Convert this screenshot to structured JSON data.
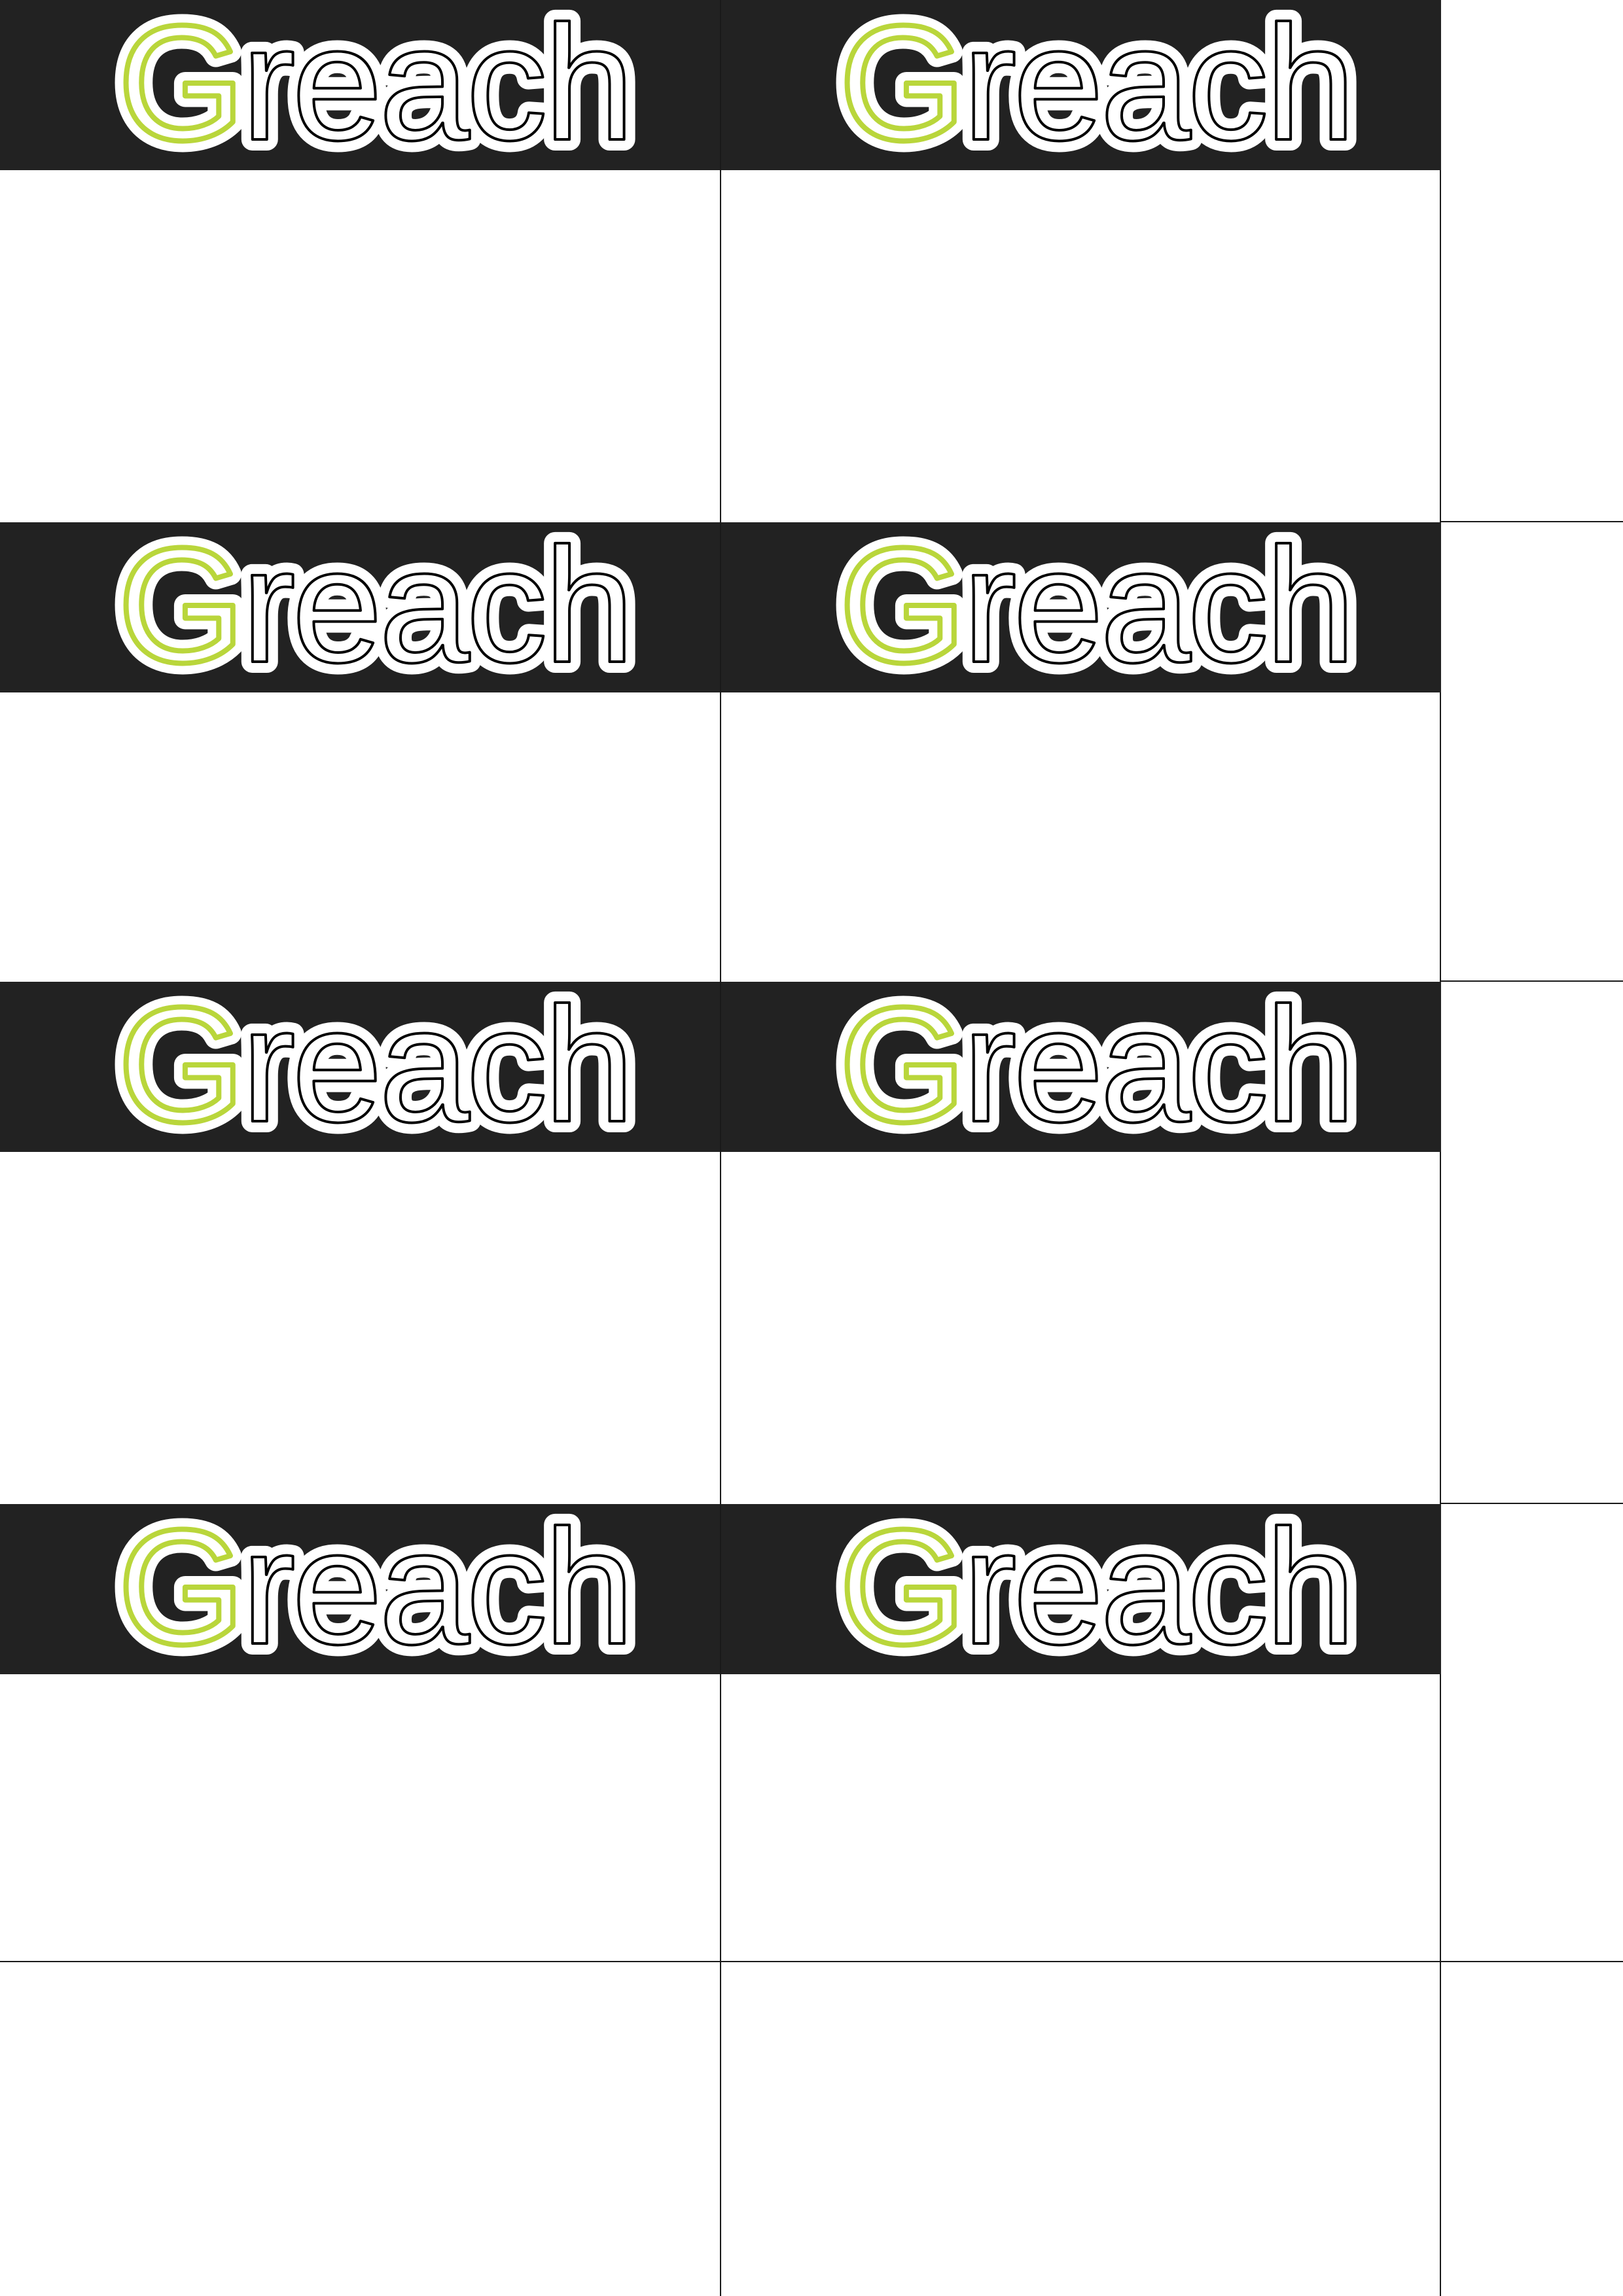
{
  "brand": {
    "first_letter": "G",
    "rest": "reach",
    "accent_color": "#b9d63b",
    "header_color": "#222222",
    "line_color": "#1a1a1a"
  },
  "cards": [
    {
      "col": 0,
      "row": 0
    },
    {
      "col": 1,
      "row": 0
    },
    {
      "col": 0,
      "row": 1
    },
    {
      "col": 1,
      "row": 1
    },
    {
      "col": 0,
      "row": 2
    },
    {
      "col": 1,
      "row": 2
    },
    {
      "col": 0,
      "row": 3
    },
    {
      "col": 1,
      "row": 3
    }
  ]
}
